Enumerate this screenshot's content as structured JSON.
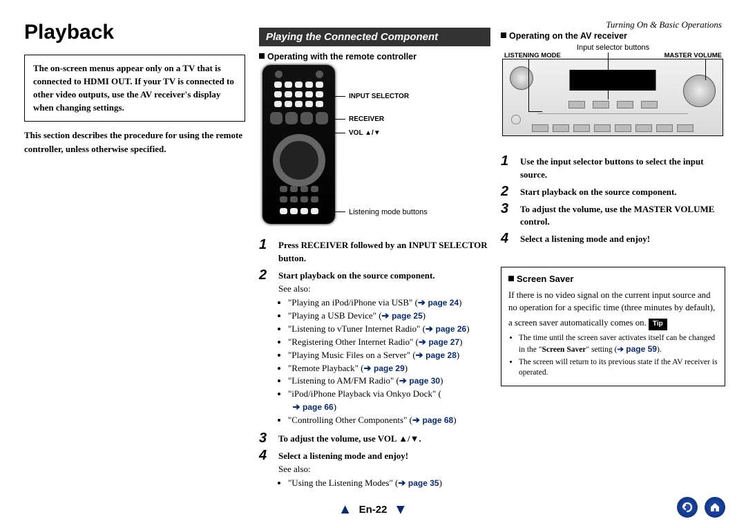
{
  "header": {
    "breadcrumb": "Turning On & Basic Operations"
  },
  "title": "Playback",
  "note1_parts": {
    "a": "The on-screen menus appear only on a TV that is connected to ",
    "b": "HDMI OUT",
    "c": ". If your TV is connected to other video outputs, use the AV receiver's display when changing settings."
  },
  "note2": "This section describes the procedure for using the remote controller, unless otherwise specified.",
  "section_bar": "Playing the Connected Component",
  "col2": {
    "subhead": "Operating with the remote controller",
    "callouts": {
      "input_selector": "INPUT SELECTOR",
      "receiver": "RECEIVER",
      "vol": "VOL ▲/▼",
      "listening_mode": "Listening mode buttons"
    },
    "steps": [
      {
        "num": "1",
        "bold": "Press RECEIVER followed by an INPUT SELECTOR button."
      },
      {
        "num": "2",
        "bold": "Start playback on the source component.",
        "plain": "See also:",
        "links": [
          {
            "t": "\"Playing an iPod/iPhone via USB\" (",
            "p": "page 24",
            "t2": ")"
          },
          {
            "t": "\"Playing a USB Device\" (",
            "p": "page 25",
            "t2": ")"
          },
          {
            "t": "\"Listening to vTuner Internet Radio\" (",
            "p": "page 26",
            "t2": ")"
          },
          {
            "t": "\"Registering Other Internet Radio\" (",
            "p": "page 27",
            "t2": ")"
          },
          {
            "t": "\"Playing Music Files on a Server\" (",
            "p": "page 28",
            "t2": ")"
          },
          {
            "t": "\"Remote Playback\" (",
            "p": "page 29",
            "t2": ")"
          },
          {
            "t": "\"Listening to AM/FM Radio\" (",
            "p": "page 30",
            "t2": ")"
          },
          {
            "t": "\"iPod/iPhone Playback via Onkyo Dock\" (",
            "p": "page 66",
            "t2": ")"
          },
          {
            "t": "\"Controlling Other Components\" (",
            "p": "page 68",
            "t2": ")"
          }
        ]
      },
      {
        "num": "3",
        "bold": "To adjust the volume, use VOL ▲/▼."
      },
      {
        "num": "4",
        "bold": "Select a listening mode and enjoy!",
        "plain": "See also:",
        "links": [
          {
            "t": "\"Using the Listening Modes\" (",
            "p": "page 35",
            "t2": ")"
          }
        ]
      }
    ]
  },
  "col3": {
    "subhead": "Operating on the AV receiver",
    "av_callouts": {
      "input_buttons": "Input selector buttons",
      "listening_mode": "LISTENING MODE",
      "master_volume": "MASTER VOLUME"
    },
    "steps": [
      {
        "num": "1",
        "bold": "Use the input selector buttons to select the input source."
      },
      {
        "num": "2",
        "bold": "Start playback on the source component."
      },
      {
        "num": "3",
        "bold": "To adjust the volume, use the MASTER VOLUME control."
      },
      {
        "num": "4",
        "bold": "Select a listening mode and enjoy!"
      }
    ],
    "screensaver": {
      "head": "Screen Saver",
      "body": "If there is no video signal on the current input source and no operation for a specific time (three minutes by default), a screen saver automatically comes on.",
      "tip_label": "Tip",
      "tips": {
        "t1a": "The time until the screen saver activates itself can be changed in the \"",
        "t1b": "Screen Saver",
        "t1c": "\" setting (",
        "t1p": "page 59",
        "t1d": ").",
        "t2": "The screen will return to its previous state if the AV receiver is operated."
      }
    }
  },
  "footer": {
    "page": "En-22"
  }
}
